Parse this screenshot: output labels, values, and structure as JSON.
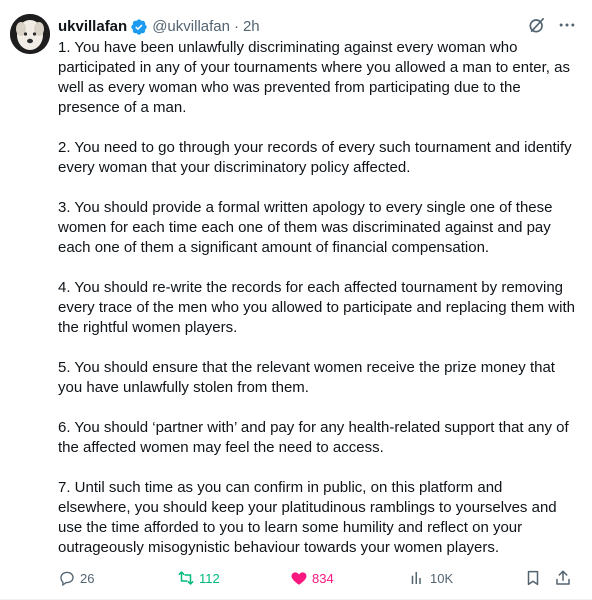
{
  "tweet": {
    "display_name": "ukvillafan",
    "handle": "@ukvillafan",
    "separator": "·",
    "time": "2h",
    "paragraphs": [
      "1. You have been unlawfully discriminating against every woman who participated in any of your tournaments where you allowed a man to enter, as well as every woman who was prevented from participating due to the presence of a man.",
      "2. You need to go through your records of every such tournament and identify every woman that your discriminatory policy affected.",
      "3. You should provide a formal written apology to every single one of these women for each time each one of them was discriminated against and pay each one of them a significant amount of financial compensation.",
      "4. You should re-write the records for each affected tournament by removing every trace of the men who you allowed to participate and replacing them with the rightful women players.",
      "5. You should ensure that the relevant women receive the prize money that you have unlawfully stolen from them.",
      "6. You should ‘partner with’ and pay for any  health-related support that any of the affected women may feel the need to access.",
      "7. Until such time as you can confirm in public, on this platform and elsewhere, you should keep your platitudinous ramblings to yourselves and use the time afforded to you to learn some humility and reflect on your outrageously misogynistic behaviour towards your women players."
    ],
    "stats": {
      "replies": "26",
      "reposts": "112",
      "likes": "834",
      "views": "10K"
    }
  },
  "colors": {
    "text": "#0f1419",
    "secondary": "#536471",
    "verified": "#1d9bf0",
    "repost_active": "#00ba7c",
    "like_active": "#f91880"
  },
  "icons": {
    "verified": "verified-badge-icon",
    "grok": "grok-icon",
    "more": "more-icon",
    "reply": "reply-icon",
    "repost": "repost-icon",
    "like": "heart-icon",
    "views": "views-icon",
    "bookmark": "bookmark-icon",
    "share": "share-icon"
  }
}
